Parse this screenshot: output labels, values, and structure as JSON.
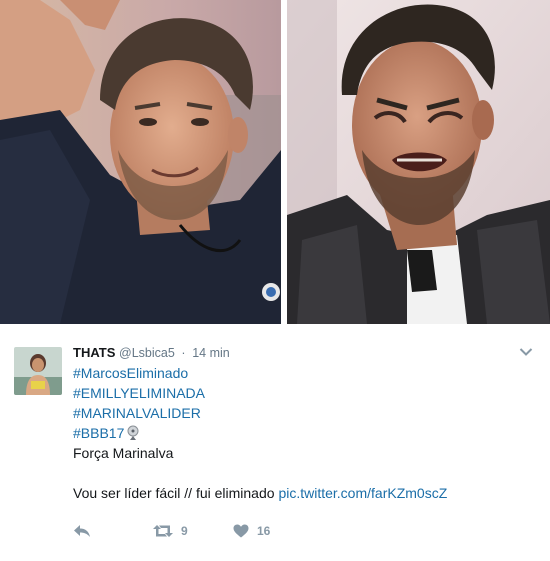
{
  "tweet": {
    "display_name": "THATS",
    "handle": "@Lsbica5",
    "separator": "·",
    "time": "14 min",
    "hashtags": [
      "#MarcosEliminado",
      "#EMILLYELIMINADA",
      "#MARINALVALIDER",
      "#BBB17"
    ],
    "line1": "Força Marinalva",
    "line2_text": "Vou ser líder fácil // fui eliminado ",
    "line2_link": "pic.twitter.com/farKZm0scZ",
    "retweet_count": "9",
    "like_count": "16"
  },
  "icons": {
    "reply": "reply-icon",
    "retweet": "retweet-icon",
    "like": "heart-icon",
    "more": "chevron-down-icon",
    "emoji": "satellite-dish-emoji"
  },
  "colors": {
    "link": "#1b6ea8",
    "muted": "#8899a6",
    "text": "#14171a"
  }
}
